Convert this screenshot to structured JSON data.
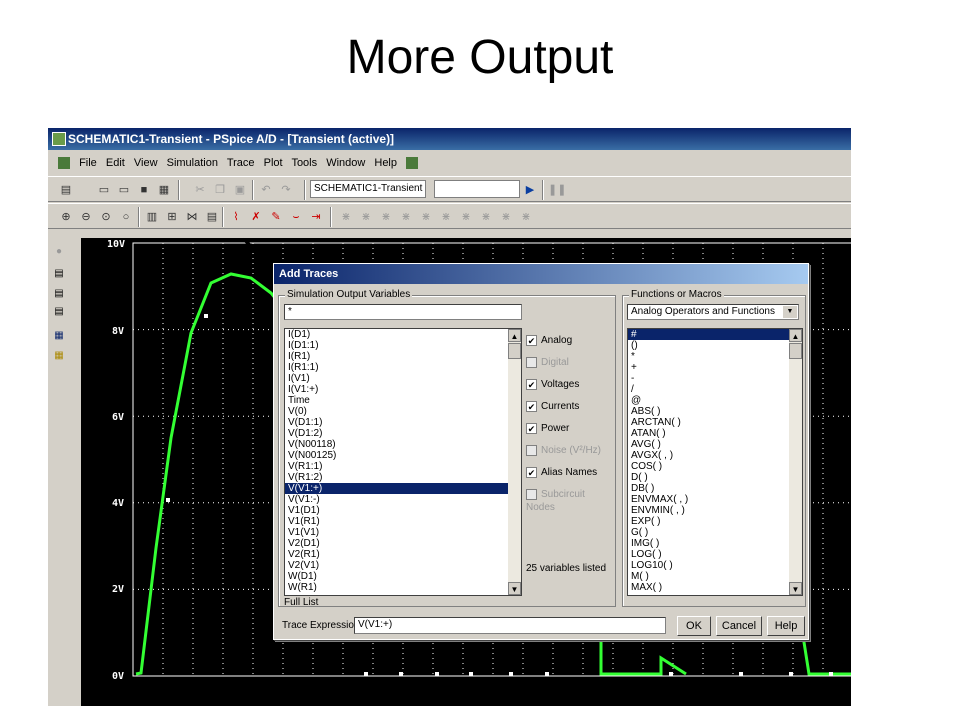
{
  "slide": {
    "title": "More Output"
  },
  "app": {
    "title": "SCHEMATIC1-Transient - PSpice A/D  - [Transient (active)]",
    "menu": [
      "File",
      "Edit",
      "View",
      "Simulation",
      "Trace",
      "Plot",
      "Tools",
      "Window",
      "Help"
    ],
    "profile_combo": "SCHEMATIC1-Transient"
  },
  "plot": {
    "y_labels": [
      "10V",
      "8V",
      "6V",
      "4V",
      "2V",
      "0V"
    ],
    "trace_color": "#33ff33"
  },
  "dialog": {
    "title": "Add Traces",
    "sim_group_label": "Simulation Output Variables",
    "filter_value": "*",
    "variables": [
      "I(D1)",
      "I(D1:1)",
      "I(R1)",
      "I(R1:1)",
      "I(V1)",
      "I(V1:+)",
      "Time",
      "V(0)",
      "V(D1:1)",
      "V(D1:2)",
      "V(N00118)",
      "V(N00125)",
      "V(R1:1)",
      "V(R1:2)",
      "V(V1:+)",
      "V(V1:-)",
      "V1(D1)",
      "V1(R1)",
      "V1(V1)",
      "V2(D1)",
      "V2(R1)",
      "V2(V1)",
      "W(D1)",
      "W(R1)"
    ],
    "selected_variable": "V(V1:+)",
    "list_footer": "Full List",
    "filters": [
      {
        "label": "Analog",
        "checked": true,
        "enabled": true
      },
      {
        "label": "Digital",
        "checked": false,
        "enabled": false
      },
      {
        "label": "Voltages",
        "checked": true,
        "enabled": true
      },
      {
        "label": "Currents",
        "checked": true,
        "enabled": true
      },
      {
        "label": "Power",
        "checked": true,
        "enabled": true
      },
      {
        "label": "Noise (V²/Hz)",
        "checked": false,
        "enabled": false
      },
      {
        "label": "Alias Names",
        "checked": true,
        "enabled": true
      },
      {
        "label": "Subcircuit Nodes",
        "checked": false,
        "enabled": false
      }
    ],
    "variables_count": "25 variables listed",
    "func_group_label": "Functions or Macros",
    "func_combo": "Analog Operators and Functions",
    "functions": [
      "#",
      "()",
      "*",
      "+",
      "-",
      "/",
      "@",
      "ABS( )",
      "ARCTAN( )",
      "ATAN( )",
      "AVG( )",
      "AVGX( , )",
      "COS( )",
      "D( )",
      "DB( )",
      "ENVMAX( , )",
      "ENVMIN( , )",
      "EXP( )",
      "G( )",
      "IMG( )",
      "LOG( )",
      "LOG10( )",
      "M( )",
      "MAX( )"
    ],
    "trace_expression_label": "Trace Expression:",
    "trace_expression_value": "V(V1:+)",
    "ok_label": "OK",
    "cancel_label": "Cancel",
    "help_label": "Help"
  }
}
